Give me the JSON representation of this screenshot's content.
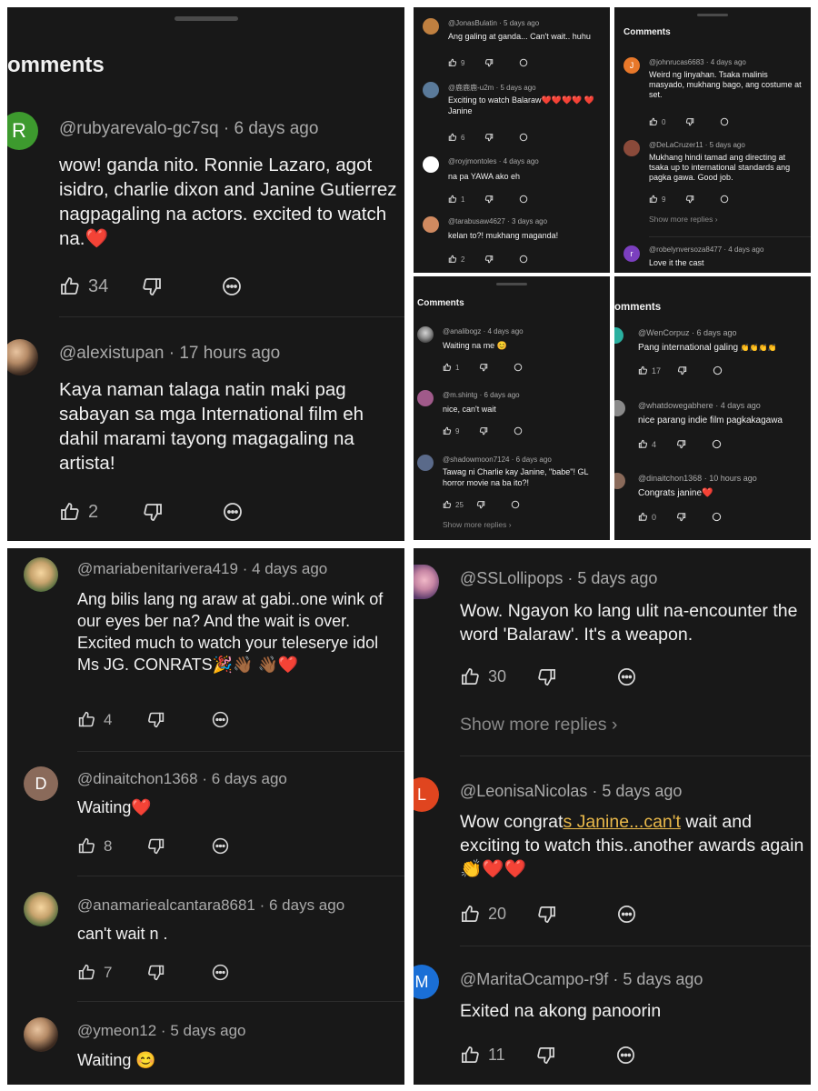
{
  "colors": {
    "panel": "#181818",
    "text": "#f1f1f1",
    "meta": "#aaaaaa",
    "highlight": "#e8b84a",
    "heart": "#e0342f"
  },
  "icons": {
    "like": "thumbs-up-icon",
    "dislike": "thumbs-down-icon",
    "reply": "reply-bubble-icon",
    "heart": "red-heart-emoji",
    "clap": "clapping-hands-emoji",
    "party": "party-popper-emoji",
    "smile": "smiling-face-emoji",
    "chevron": "chevron-right-icon"
  },
  "panel1": {
    "title": "omments",
    "comments": [
      {
        "avatar_letter": "R",
        "avatar_color": "#3d9a2e",
        "user": "@rubyarevalo-gc7sq",
        "time": "6 days ago",
        "text": "wow! ganda nito. Ronnie Lazaro, agot isidro, charlie dixon and Janine Gutierrez nagpagaling na actors. excited to watch na.",
        "emoji": "❤️",
        "likes": "34"
      },
      {
        "avatar_letter": "",
        "avatar_color": "#c7602a",
        "user": "@alexistupan",
        "time": "17 hours ago",
        "text": "Kaya naman talaga natin maki pag sabayan sa mga International film eh dahil marami tayong magagaling na artista!",
        "likes": "2"
      }
    ]
  },
  "panel2": {
    "comments": [
      {
        "avatar_color": "#c08040",
        "user": "@JonasBulatin",
        "time": "5 days ago",
        "text": "Ang galing at ganda... Can't wait.. huhu",
        "likes": "9"
      },
      {
        "avatar_color": "#5a7a9a",
        "user": "@鹿鹿鹿-u2m",
        "time": "5 days ago",
        "text": "Exciting to watch Balaraw❤️❤️❤️❤️ ❤️Janine",
        "likes": "6"
      },
      {
        "avatar_color": "#ffffff",
        "user": "@royjmontoles",
        "time": "4 days ago",
        "text": "na pa YAWA ako eh",
        "likes": "1"
      },
      {
        "avatar_color": "#d08a60",
        "user": "@tarabusaw4627",
        "time": "3 days ago",
        "text": "kelan to?! mukhang maganda!",
        "likes": "2"
      }
    ]
  },
  "panel3": {
    "title": "Comments",
    "comments": [
      {
        "avatar_letter": "J",
        "avatar_color": "#e8782a",
        "user": "@johnrucas6683",
        "time": "4 days ago",
        "text": "Weird ng linyahan. Tsaka malinis masyado, mukhang bago, ang costume at set.",
        "likes": "0"
      },
      {
        "avatar_letter": "",
        "avatar_color": "#8a4a3a",
        "user": "@DeLaCruzer11",
        "time": "5 days ago",
        "text": "Mukhang hindi tamad ang directing at tsaka up to international standards ang pagka gawa.  Good job.",
        "likes": "9"
      },
      {
        "avatar_letter": "r",
        "avatar_color": "#7b3fbf",
        "user": "@robelynversoza8477",
        "time": "4 days ago",
        "text": "Love it the cast"
      }
    ],
    "show_more": "Show more replies"
  },
  "panel4": {
    "title": "Comments",
    "comments": [
      {
        "avatar_color": "#d8c8a8",
        "user": "@analibogz",
        "time": "4 days ago",
        "text": "Waiting na me 😊",
        "likes": "1"
      },
      {
        "avatar_color": "#a05a8a",
        "user": "@m.shintg",
        "time": "6 days ago",
        "text": "nice, can't wait",
        "likes": "9"
      },
      {
        "avatar_color": "#5a6a8a",
        "user": "@shadowmoon7124",
        "time": "6 days ago",
        "text": "Tawag ni Charlie kay Janine, \"babe\"! GL horror movie na ba ito?!",
        "likes": "25"
      }
    ],
    "show_more": "Show more replies"
  },
  "panel5": {
    "title": "omments",
    "comments": [
      {
        "avatar_color": "#2ab0a0",
        "user": "@WenCorpuz",
        "time": "6 days ago",
        "text": "Pang international galing",
        "emoji": "👏👏👏👏",
        "likes": "17"
      },
      {
        "avatar_color": "#8a8a8a",
        "user": "@whatdowegabhere",
        "time": "4 days ago",
        "text": "nice parang indie film pagkakagawa",
        "likes": "4"
      },
      {
        "avatar_color": "#8a6a5a",
        "user": "@dinaitchon1368",
        "time": "10 hours ago",
        "text": "Congrats janine",
        "emoji": "❤️",
        "likes": "0"
      }
    ]
  },
  "panel6": {
    "comments": [
      {
        "user": "@mariabenitarivera419",
        "time": "4 days ago",
        "text": "Ang bilis lang ng araw at gabi..one wink of our eyes ber na? And the wait is over. Excited much to watch your teleserye idol Ms JG. CONRATS",
        "emoji": "🎉👋🏾 👋🏾❤️",
        "likes": "4"
      },
      {
        "avatar_letter": "D",
        "avatar_color": "#8a6a5a",
        "user": "@dinaitchon1368",
        "time": "6 days ago",
        "text": "Waiting",
        "emoji": "❤️",
        "likes": "8"
      },
      {
        "user": "@anamariealcantara8681",
        "time": "6 days ago",
        "text": "can't wait n .",
        "likes": "7"
      },
      {
        "user": "@ymeon12",
        "time": "5 days ago",
        "text": "Waiting",
        "emoji": "😊"
      }
    ]
  },
  "panel7": {
    "comments": [
      {
        "user": "@SSLollipops",
        "time": "5 days ago",
        "text": "Wow. Ngayon ko lang ulit na-encounter the word 'Balaraw'. It's a weapon.",
        "likes": "30"
      },
      {
        "avatar_letter": "L",
        "avatar_color": "#e0451f",
        "user": "@LeonisaNicolas",
        "time": "5 days ago",
        "text_pre": "Wow congrat",
        "text_hl": "s Janine...can't",
        "text_post": " wait and exciting to watch this..another awards again",
        "emoji": "👏❤️❤️",
        "likes": "20"
      },
      {
        "avatar_letter": "M",
        "avatar_color": "#1a6fd6",
        "user": "@MaritaOcampo-r9f",
        "time": "5 days ago",
        "text": "Exited na akong panoorin",
        "likes": "11"
      }
    ],
    "show_more": "Show more replies"
  }
}
